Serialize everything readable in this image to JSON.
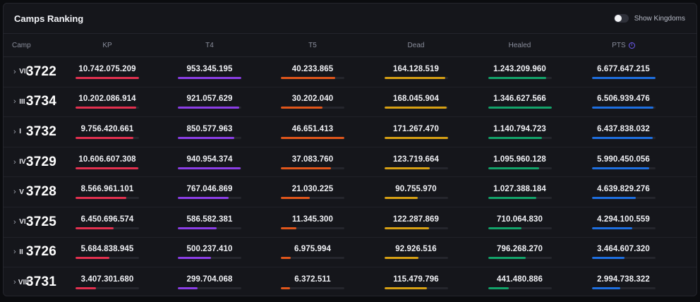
{
  "header": {
    "title": "Camps Ranking",
    "toggle_label": "Show Kingdoms",
    "toggle_on": false
  },
  "columns": {
    "camp": "Camp",
    "kp": "KP",
    "t4": "T4",
    "t5": "T5",
    "dead": "Dead",
    "healed": "Healed",
    "pts": "PTS"
  },
  "colors": {
    "kp": "#e2304f",
    "t4": "#8b3ee6",
    "t5": "#e0561b",
    "dead": "#d6a014",
    "healed": "#13a36a",
    "pts": "#1e6fe0"
  },
  "rows": [
    {
      "roman": "VII",
      "id": "3722",
      "kp": "10.742.075.209",
      "t4": "953.345.195",
      "t5": "40.233.865",
      "dead": "164.128.519",
      "healed": "1.243.209.960",
      "pts": "6.677.647.215",
      "pct": {
        "kp": 100,
        "t4": 100,
        "t5": 86,
        "dead": 96,
        "healed": 92,
        "pts": 100
      }
    },
    {
      "roman": "III",
      "id": "3734",
      "kp": "10.202.086.914",
      "t4": "921.057.629",
      "t5": "30.202.040",
      "dead": "168.045.904",
      "healed": "1.346.627.566",
      "pts": "6.506.939.476",
      "pct": {
        "kp": 95,
        "t4": 97,
        "t5": 65,
        "dead": 98,
        "healed": 100,
        "pts": 97
      }
    },
    {
      "roman": "I",
      "id": "3732",
      "kp": "9.756.420.661",
      "t4": "850.577.963",
      "t5": "46.651.413",
      "dead": "171.267.470",
      "healed": "1.140.794.723",
      "pts": "6.437.838.032",
      "pct": {
        "kp": 91,
        "t4": 89,
        "t5": 100,
        "dead": 100,
        "healed": 85,
        "pts": 96
      }
    },
    {
      "roman": "IV",
      "id": "3729",
      "kp": "10.606.607.308",
      "t4": "940.954.374",
      "t5": "37.083.760",
      "dead": "123.719.664",
      "healed": "1.095.960.128",
      "pts": "5.990.450.056",
      "pct": {
        "kp": 99,
        "t4": 99,
        "t5": 79,
        "dead": 72,
        "healed": 81,
        "pts": 90
      }
    },
    {
      "roman": "V",
      "id": "3728",
      "kp": "8.566.961.101",
      "t4": "767.046.869",
      "t5": "21.030.225",
      "dead": "90.755.970",
      "healed": "1.027.388.184",
      "pts": "4.639.829.276",
      "pct": {
        "kp": 80,
        "t4": 80,
        "t5": 45,
        "dead": 53,
        "healed": 76,
        "pts": 69
      }
    },
    {
      "roman": "VI",
      "id": "3725",
      "kp": "6.450.696.574",
      "t4": "586.582.381",
      "t5": "11.345.300",
      "dead": "122.287.869",
      "healed": "710.064.830",
      "pts": "4.294.100.559",
      "pct": {
        "kp": 60,
        "t4": 61,
        "t5": 24,
        "dead": 71,
        "healed": 53,
        "pts": 64
      }
    },
    {
      "roman": "II",
      "id": "3726",
      "kp": "5.684.838.945",
      "t4": "500.237.410",
      "t5": "6.975.994",
      "dead": "92.926.516",
      "healed": "796.268.270",
      "pts": "3.464.607.320",
      "pct": {
        "kp": 53,
        "t4": 52,
        "t5": 15,
        "dead": 54,
        "healed": 59,
        "pts": 52
      }
    },
    {
      "roman": "VIII",
      "id": "3731",
      "kp": "3.407.301.680",
      "t4": "299.704.068",
      "t5": "6.372.511",
      "dead": "115.479.796",
      "healed": "441.480.886",
      "pts": "2.994.738.322",
      "pct": {
        "kp": 32,
        "t4": 31,
        "t5": 14,
        "dead": 67,
        "healed": 33,
        "pts": 45
      }
    }
  ]
}
